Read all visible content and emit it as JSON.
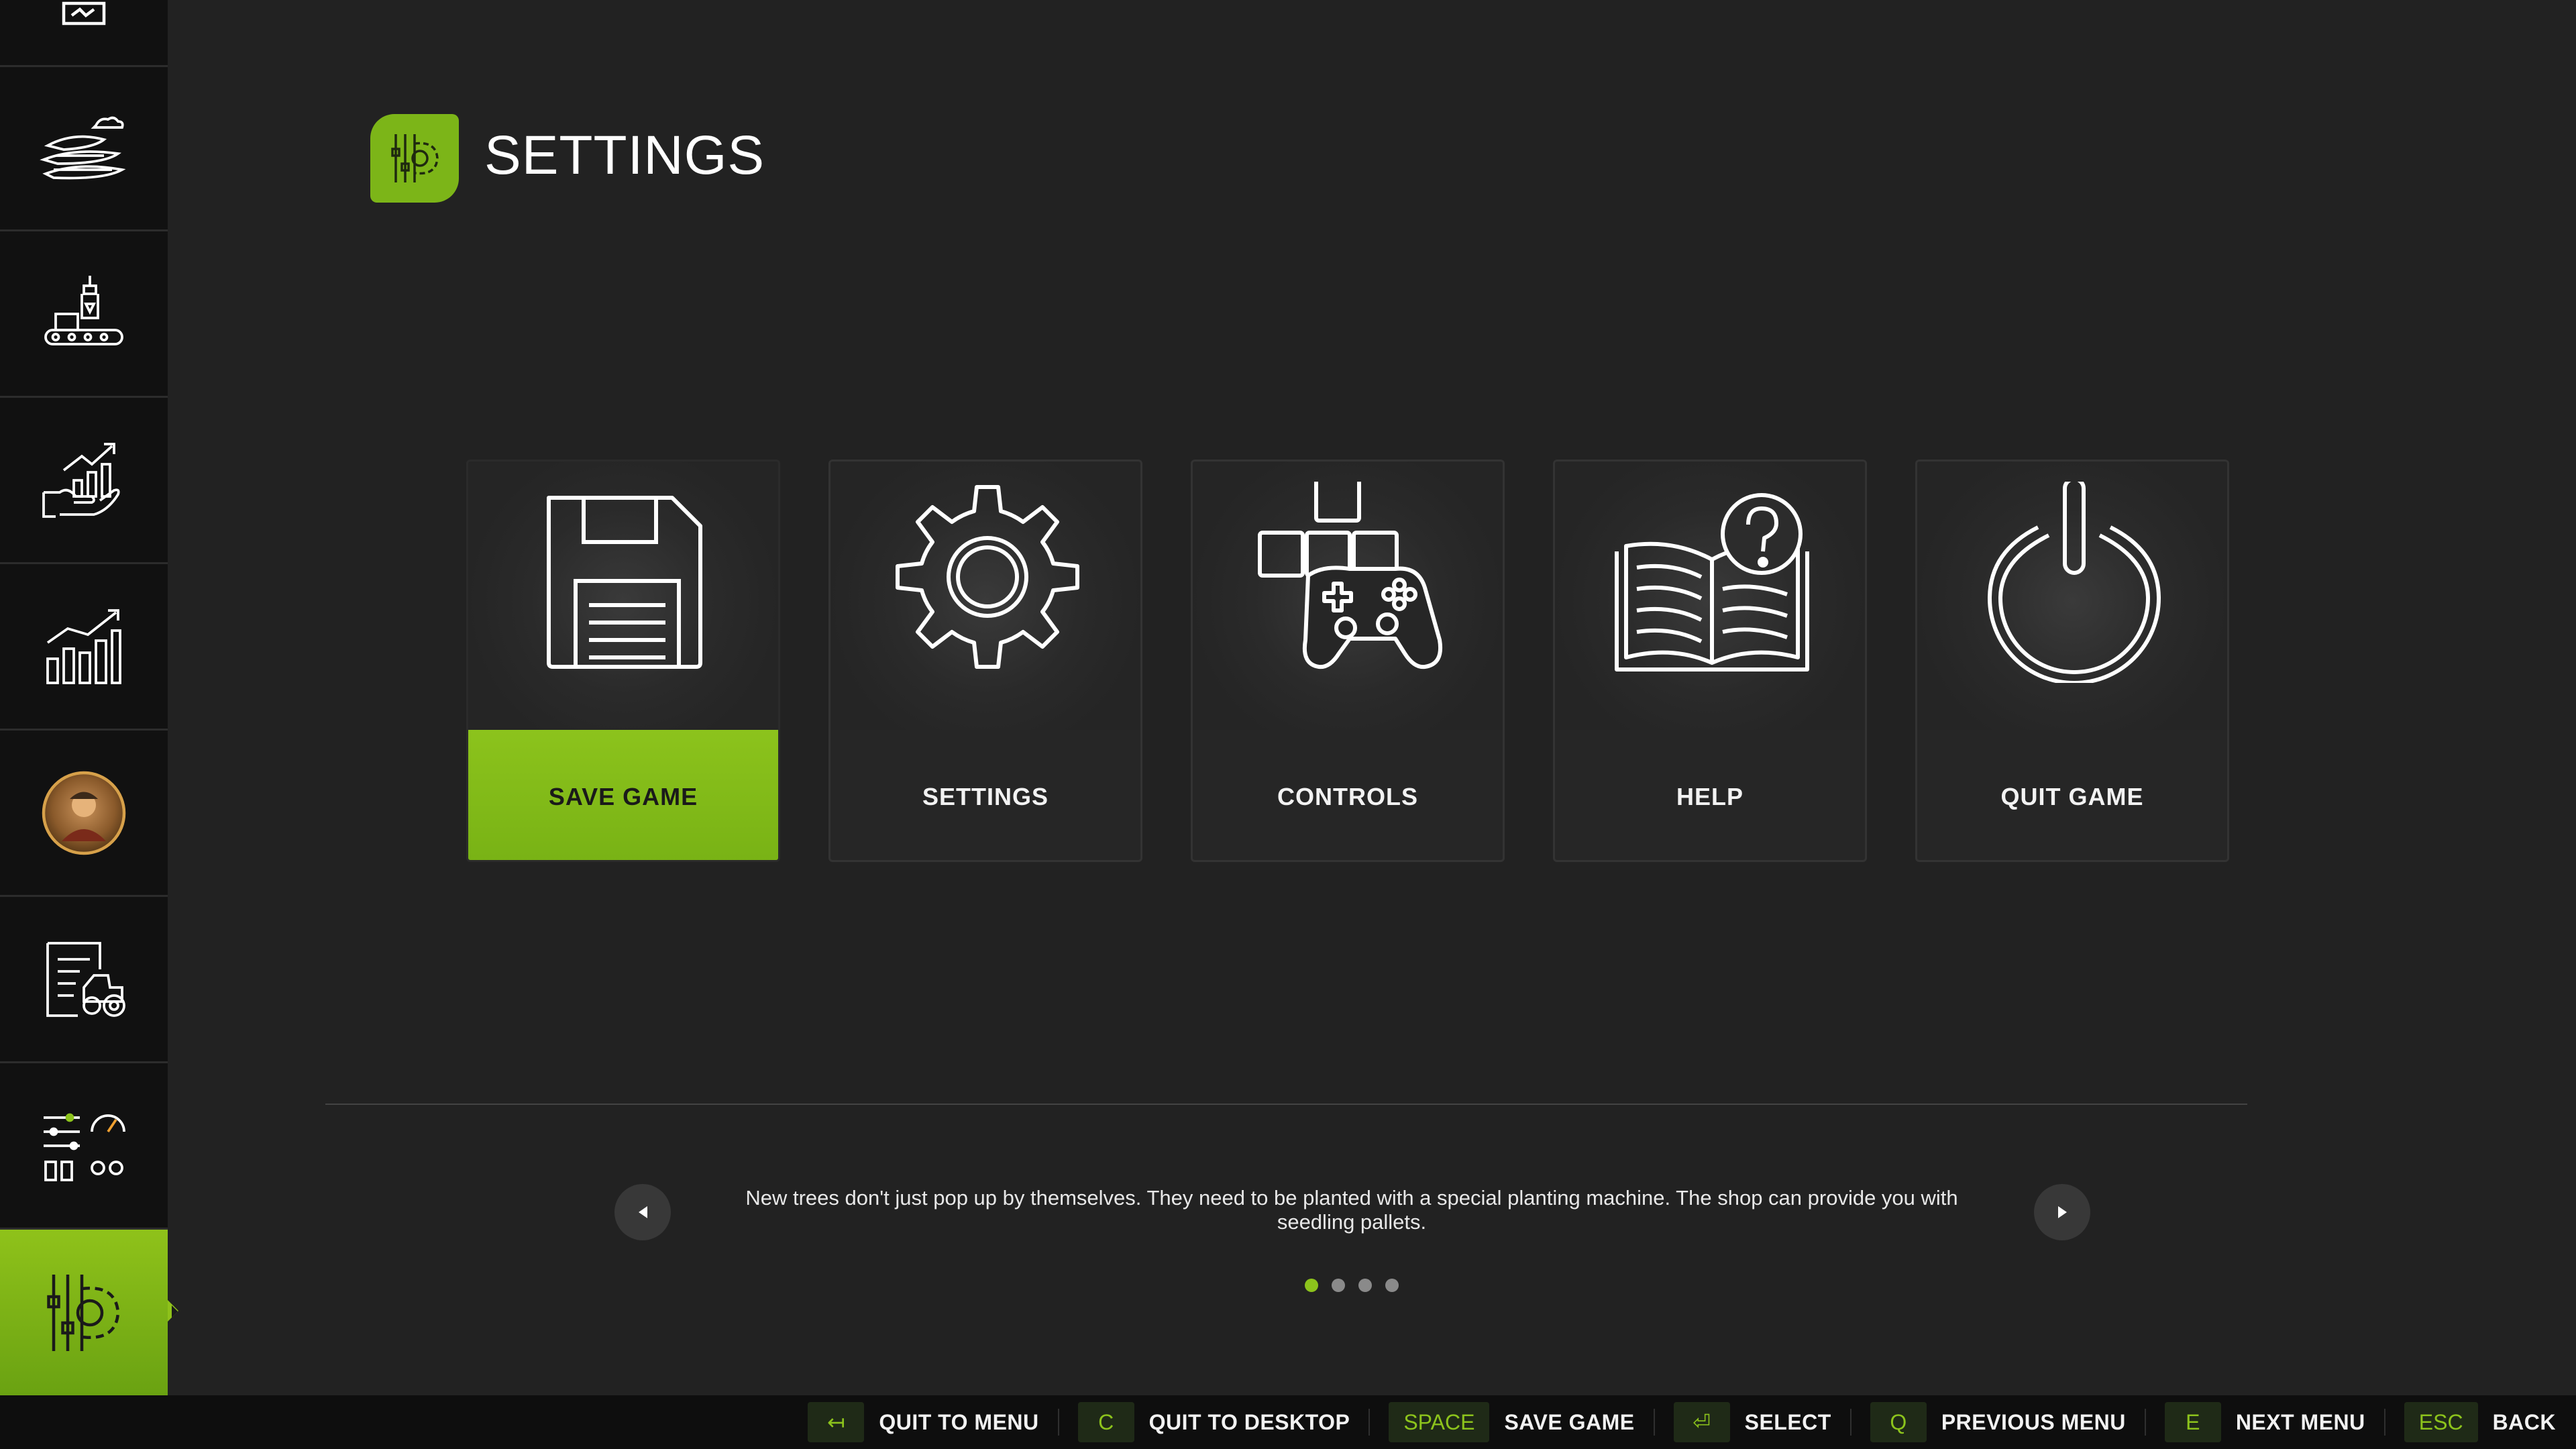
{
  "header": {
    "title": "SETTINGS",
    "icon": "settings-sliders-gear-icon"
  },
  "sidebar": {
    "items": [
      {
        "icon": "map-icon",
        "active": false
      },
      {
        "icon": "weather-fields-icon",
        "active": false
      },
      {
        "icon": "production-robot-icon",
        "active": false
      },
      {
        "icon": "finance-growth-hand-icon",
        "active": false
      },
      {
        "icon": "statistics-bar-chart-icon",
        "active": false
      },
      {
        "icon": "player-avatar-icon",
        "active": false
      },
      {
        "icon": "vehicle-list-icon",
        "active": false
      },
      {
        "icon": "gauges-sliders-icon",
        "active": false
      },
      {
        "icon": "settings-sliders-gear-icon",
        "active": true
      }
    ]
  },
  "cards": [
    {
      "label": "SAVE GAME",
      "icon": "floppy-disk-icon",
      "selected": true
    },
    {
      "label": "SETTINGS",
      "icon": "gear-icon",
      "selected": false
    },
    {
      "label": "CONTROLS",
      "icon": "gamepad-keys-icon",
      "selected": false
    },
    {
      "label": "HELP",
      "icon": "book-question-icon",
      "selected": false
    },
    {
      "label": "QUIT GAME",
      "icon": "power-icon",
      "selected": false
    }
  ],
  "tips": {
    "text": "New trees don't just pop up by themselves. They need to be planted with a special planting machine. The shop can provide you with seedling pallets.",
    "pages": 4,
    "current_page": 1
  },
  "hints": [
    {
      "key": "↤",
      "label": "QUIT TO MENU"
    },
    {
      "key": "C",
      "label": "QUIT TO DESKTOP"
    },
    {
      "key": "SPACE",
      "label": "SAVE GAME"
    },
    {
      "key": "⏎",
      "label": "SELECT"
    },
    {
      "key": "Q",
      "label": "PREVIOUS MENU"
    },
    {
      "key": "E",
      "label": "NEXT MENU"
    },
    {
      "key": "ESC",
      "label": "BACK"
    }
  ],
  "colors": {
    "accent": "#8cc31c",
    "background": "#222222",
    "sidebar": "#111111"
  }
}
